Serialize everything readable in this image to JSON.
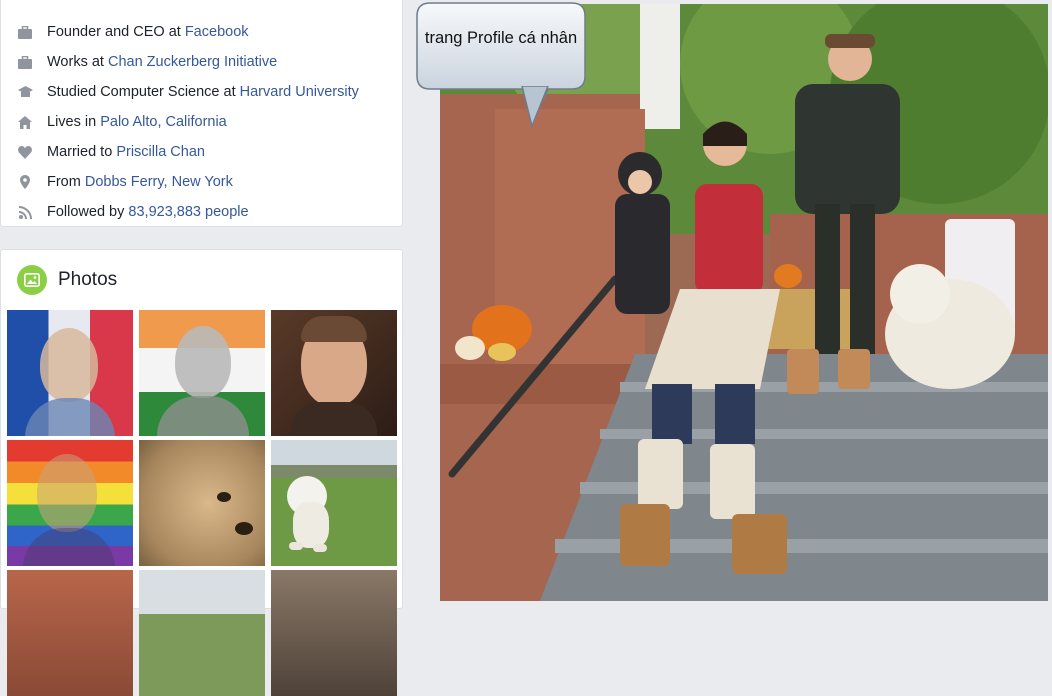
{
  "intro": {
    "items": [
      {
        "icon": "briefcase-icon",
        "prefix": "Founder and CEO at ",
        "link": "Facebook",
        "suffix": ""
      },
      {
        "icon": "briefcase-icon",
        "prefix": "Works at ",
        "link": "Chan Zuckerberg Initiative",
        "suffix": ""
      },
      {
        "icon": "graduation-cap-icon",
        "prefix": "Studied Computer Science at ",
        "link": "Harvard University",
        "suffix": ""
      },
      {
        "icon": "home-icon",
        "prefix": "Lives in ",
        "link": "Palo Alto, California",
        "suffix": ""
      },
      {
        "icon": "heart-icon",
        "prefix": "Married to ",
        "link": "Priscilla Chan",
        "suffix": ""
      },
      {
        "icon": "location-pin-icon",
        "prefix": "From ",
        "link": "Dobbs Ferry, New York",
        "suffix": ""
      },
      {
        "icon": "rss-icon",
        "prefix": "Followed by ",
        "link": "83,923,883 people",
        "suffix": ""
      }
    ]
  },
  "photos": {
    "title": "Photos",
    "thumbnails": [
      "french-flag-profile-photo",
      "india-flag-profile-photo",
      "portrait-photo",
      "rainbow-profile-photo",
      "puppy-closeup-photo",
      "white-puppy-on-grass-photo",
      "partial-photo-1",
      "partial-photo-2",
      "partial-photo-3"
    ]
  },
  "annotation": {
    "text": "trang Profile cá nhân"
  },
  "colors": {
    "link": "#365899",
    "text": "#1d2129",
    "icon": "#90949c",
    "background": "#e9ebee",
    "photos_icon": "#8ccf47"
  }
}
